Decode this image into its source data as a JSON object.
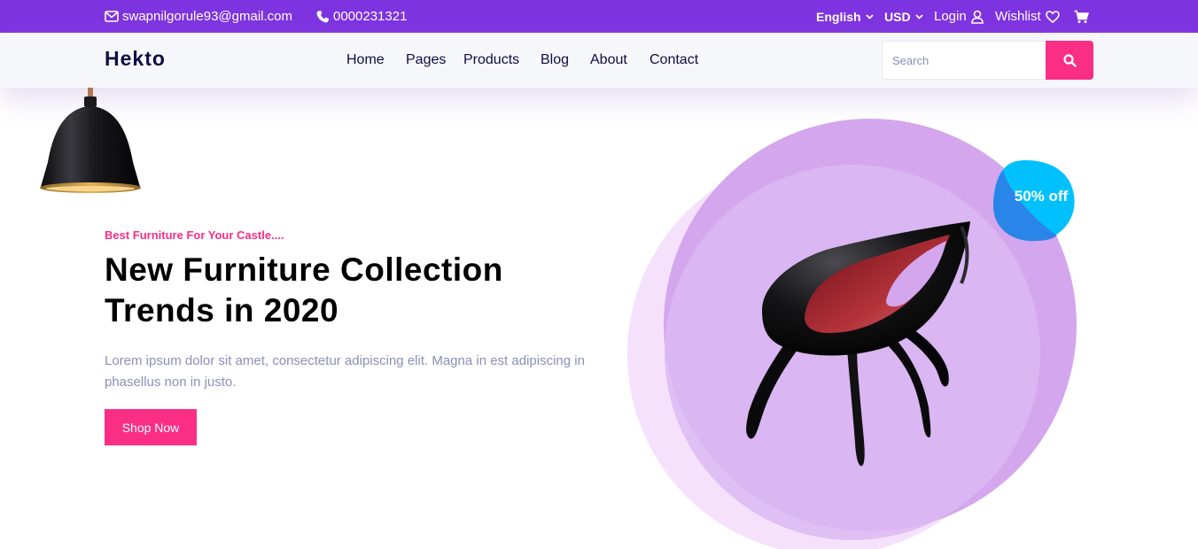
{
  "topbar": {
    "email": "swapnilgorule93@gmail.com",
    "phone": "0000231321",
    "language": "English",
    "currency": "USD",
    "login": "Login",
    "wishlist": "Wishlist",
    "icons": [
      "mail-icon",
      "phone-icon",
      "chevron-down-icon",
      "user-icon",
      "heart-icon",
      "cart-icon"
    ]
  },
  "nav": {
    "logo": "Hekto",
    "links": [
      "Home",
      "Pages",
      "Products",
      "Blog",
      "About",
      "Contact"
    ],
    "search_placeholder": "Search"
  },
  "hero": {
    "tagline": "Best Furniture For Your Castle....",
    "headline_line1": "New Furniture Collection",
    "headline_line2": "Trends in 2020",
    "description": "Lorem ipsum dolor sit amet, consectetur adipiscing elit. Magna in est adipiscing in phasellus non in justo.",
    "cta": "Shop Now",
    "discount_badge": "50% off"
  },
  "colors": {
    "topbar": "#7e33e0",
    "accent_pink": "#fb2e86",
    "navy": "#0d0e43",
    "muted": "#8a8fb9",
    "circle_outer": "#f5e1fc",
    "circle_inner": "#d9b5f2",
    "badge": "#00c1fe"
  }
}
